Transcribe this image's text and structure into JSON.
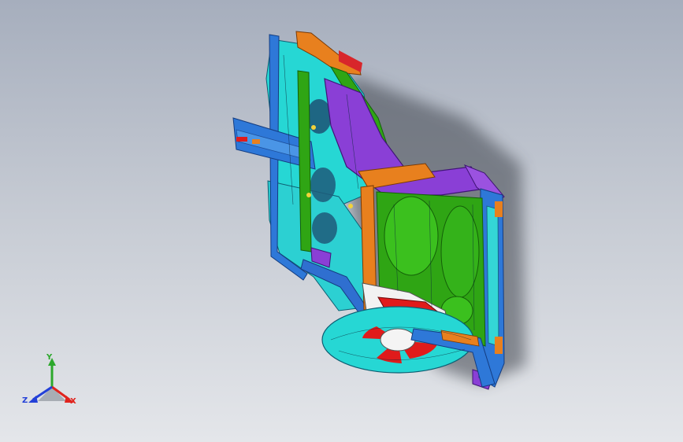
{
  "viewport": {
    "background_top": "#a6aebd",
    "background_bottom": "#e4e6ea"
  },
  "model": {
    "icon": "cad-assembly-3d-model",
    "colors": {
      "cyan": "#26d7d4",
      "blue": "#2e78d8",
      "purple": "#8a3fd6",
      "green": "#2fa514",
      "orange": "#e8801e",
      "red": "#e01b1b",
      "white": "#f2f2f2"
    }
  },
  "triad": {
    "y_label": "Y",
    "x_label": "X",
    "z_label": "Z",
    "y_color": "#2ca82c",
    "x_color": "#e0241e",
    "z_color": "#2340d8"
  }
}
